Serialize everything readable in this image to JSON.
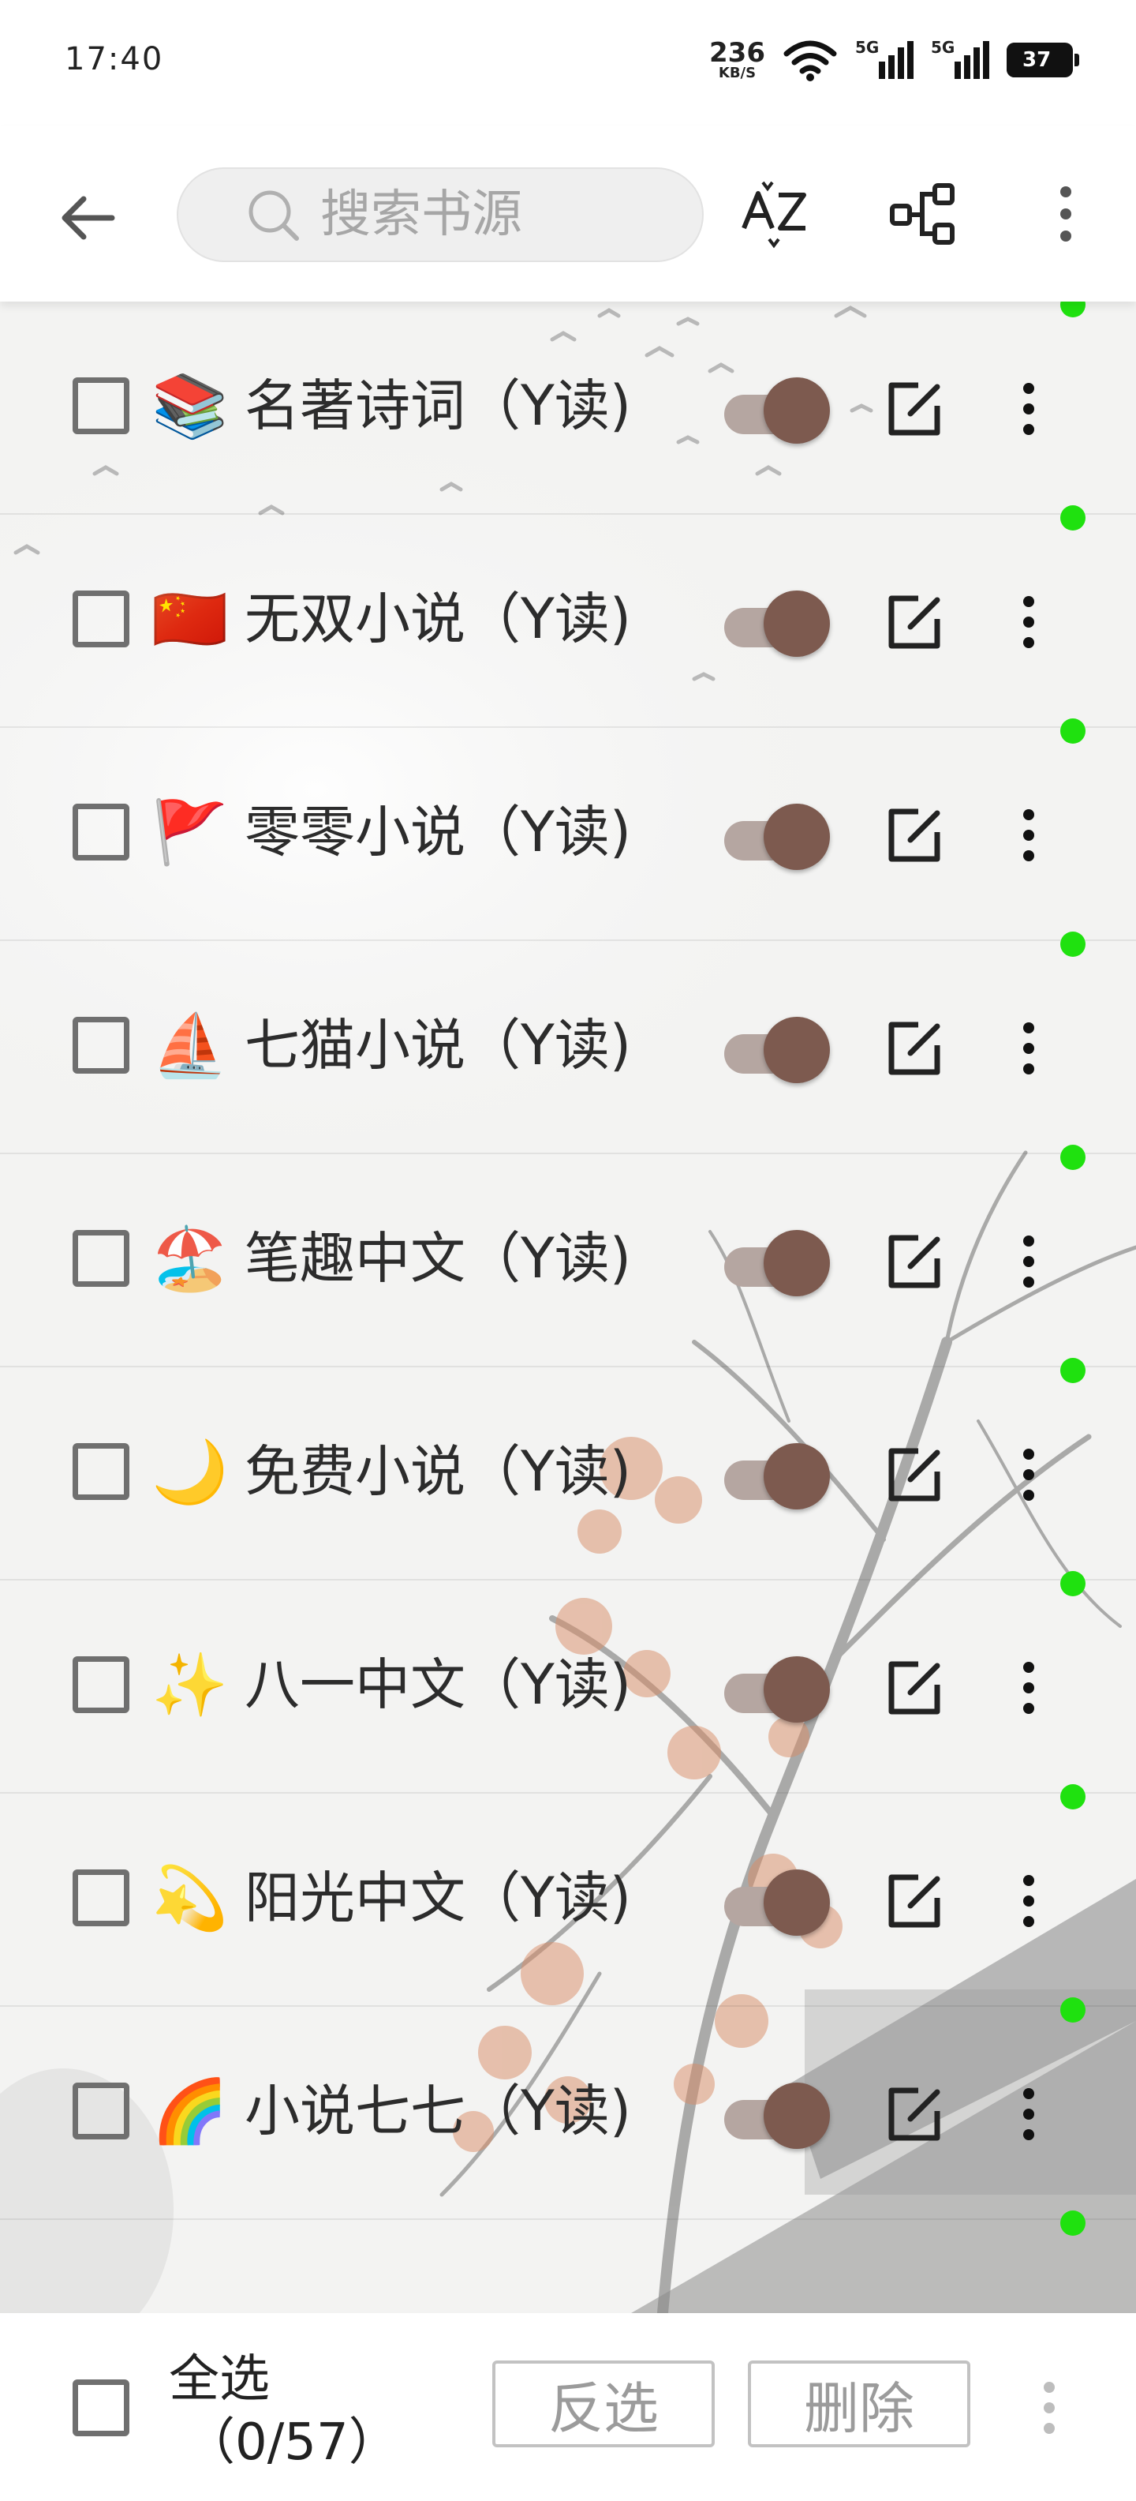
{
  "status_bar": {
    "time": "17:40",
    "net_speed_value": "236",
    "net_speed_unit": "KB/S",
    "signal_1_label": "5G",
    "signal_2_label": "5G",
    "battery": "37"
  },
  "toolbar": {
    "search_placeholder": "搜索书源",
    "sort_icon": "az-sort-icon",
    "group_icon": "group-tree-icon",
    "more_icon": "overflow-menu-icon"
  },
  "sources": [
    {
      "emoji": "📚",
      "name": "名著诗词（Y读)",
      "enabled": true,
      "checked": false
    },
    {
      "emoji": "🇨🇳",
      "name": "无双小说（Y读)",
      "enabled": true,
      "checked": false
    },
    {
      "emoji": "🚩",
      "name": "零零小说（Y读)",
      "enabled": true,
      "checked": false
    },
    {
      "emoji": "⛵",
      "name": "七猫小说（Y读)",
      "enabled": true,
      "checked": false
    },
    {
      "emoji": "🏖️",
      "name": "笔趣中文（Y读)",
      "enabled": true,
      "checked": false
    },
    {
      "emoji": "🌙",
      "name": "免费小说（Y读)",
      "enabled": true,
      "checked": false
    },
    {
      "emoji": "✨",
      "name": "八一中文（Y读)",
      "enabled": true,
      "checked": false
    },
    {
      "emoji": "💫",
      "name": "阳光中文（Y读)",
      "enabled": true,
      "checked": false
    },
    {
      "emoji": "🌈",
      "name": "小说七七（Y读)",
      "enabled": true,
      "checked": false
    }
  ],
  "bottom_bar": {
    "select_all_label": "全选",
    "selection_count": "（0/57）",
    "invert_label": "反选",
    "delete_label": "删除"
  },
  "colors": {
    "switch_thumb": "#7d5a4f",
    "switch_track": "#b5a6a1",
    "status_dot": "#1fe10f"
  }
}
